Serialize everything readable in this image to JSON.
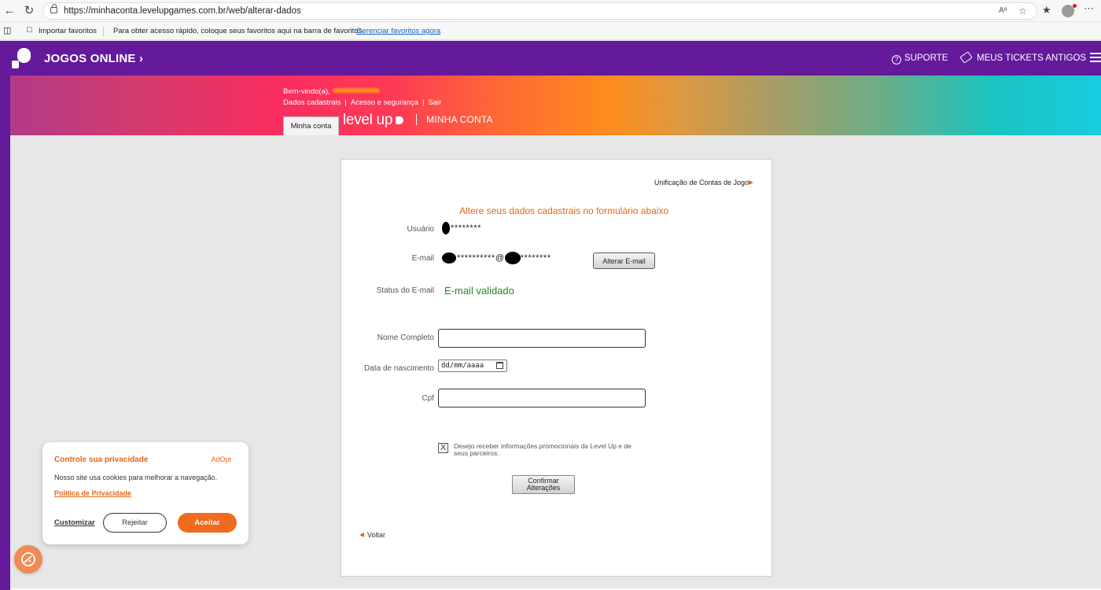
{
  "browser": {
    "url": "https://minhaconta.levelupgames.com.br/web/alterar-dados",
    "read_aloud_icon": "Aᵃ",
    "favorites": {
      "import_label": "Importar favoritos",
      "message": "Para obter acesso rápido, coloque seus favoritos aqui na barra de favoritos.",
      "manage_link": "Gerenciar favoritos agora"
    }
  },
  "site_header": {
    "title": "JOGOS ONLINE",
    "title_chevron": "›",
    "support_label": "SUPORTE",
    "tickets_label": "MEUS TICKETS ANTIGOS"
  },
  "banner": {
    "welcome": "Bem-vindo(a),",
    "links": [
      "Dados cadastrais",
      "Acesso e segurança",
      "Sair"
    ],
    "tab_label": "Minha conta",
    "brand": "level up",
    "brand_sub": "MINHA CONTA"
  },
  "form": {
    "unification_link": "Unificação de Contas de Jogo",
    "title": "Altere seus dados cadastrais no formulário abaixo",
    "user_label": "Usuário",
    "user_value_masked": "********",
    "email_label": "E-mail",
    "email_value_masked_1": "**********",
    "email_at": "@",
    "email_value_masked_2": "********",
    "change_email_button": "Alterar E-mail",
    "email_status_label": "Status do E-mail",
    "email_status_value": "E-mail validado",
    "fullname_label": "Nome Completo",
    "fullname_value": "",
    "birthdate_label": "Data de nascimento",
    "birthdate_placeholder": "dd/mm/aaaa",
    "cpf_label": "Cpf",
    "cpf_value": "",
    "promo_checkbox_checked": true,
    "promo_checkbox_mark": "X",
    "promo_text": "Desejo receber informações promocionais da Level Up e de seus parceiros.",
    "confirm_button_line1": "Confirmar",
    "confirm_button_line2": "Alterações",
    "back_link": "Voltar"
  },
  "cookie_popup": {
    "title": "Controle sua privacidade",
    "brand": "AdOpt",
    "message": "Nosso site usa cookies para melhorar a navegação.",
    "privacy_link": "Política de Privacidade",
    "customize_label": "Customizar",
    "reject_label": "Rejeitar",
    "accept_label": "Aceitar"
  },
  "colors": {
    "header_purple": "#641a9b",
    "accent_orange": "#e8641a",
    "status_green": "#1e8a1e",
    "accept_orange": "#f06a1f"
  }
}
